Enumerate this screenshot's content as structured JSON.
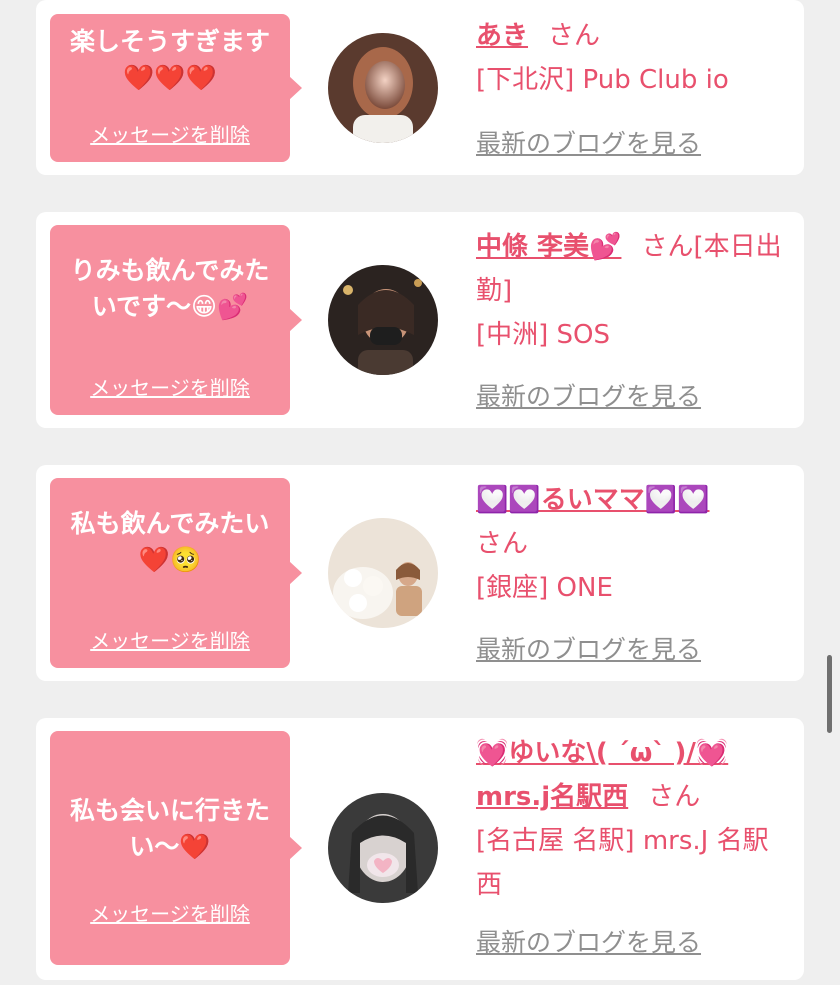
{
  "messages": [
    {
      "message": "楽しそうすぎます\n❤️❤️❤️",
      "delete_label": "メッセージを削除",
      "name": "あき",
      "honorific": "さん",
      "shop": "[下北沢] Pub Club io",
      "blog_link": "最新のブログを見る"
    },
    {
      "message": "りみも飲んでみた\nいです〜😁💕",
      "delete_label": "メッセージを削除",
      "name": "中條 李美💕",
      "honorific": "さん[本日出勤]",
      "shop": "[中洲] SOS",
      "blog_link": "最新のブログを見る"
    },
    {
      "message": "私も飲んでみたい\n❤️🥺",
      "delete_label": "メッセージを削除",
      "name": "💟💟るいママ💟💟",
      "honorific": "さん",
      "shop": "[銀座] ONE",
      "blog_link": "最新のブログを見る"
    },
    {
      "message": "私も会いに行きた\nい〜❤️",
      "delete_label": "メッセージを削除",
      "name": "💓ゆいな\\( ´ω` )/💓mrs.j名駅西",
      "honorific": "さん",
      "shop": "[名古屋 名駅] mrs.J 名駅西",
      "blog_link": "最新のブログを見る"
    }
  ],
  "colors": {
    "bubble": "#f7909f",
    "accent": "#e8506d",
    "link_gray": "#8f8f8f",
    "background": "#efefef"
  }
}
